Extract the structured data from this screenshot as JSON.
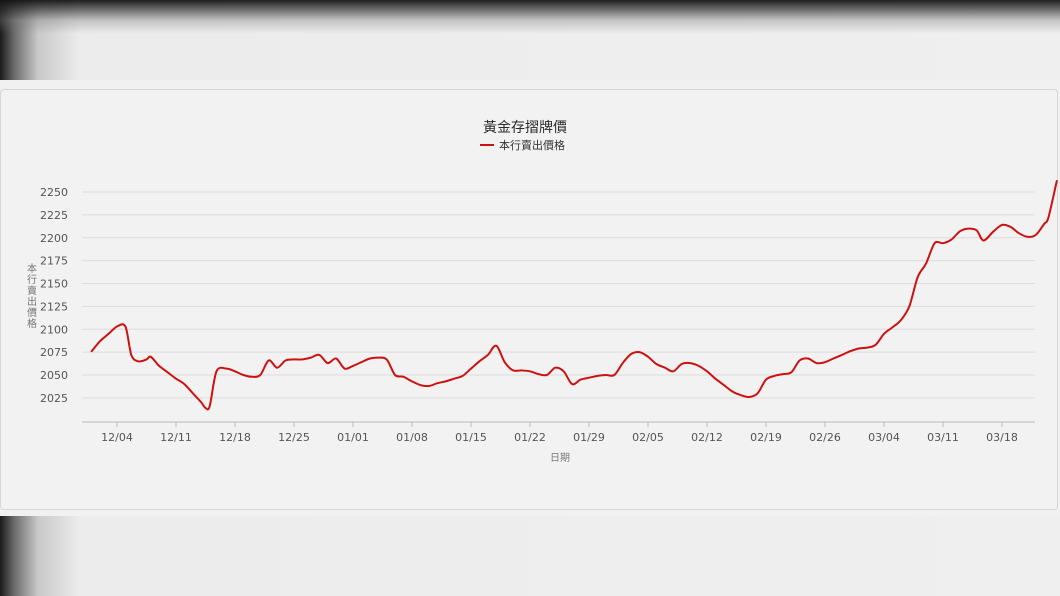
{
  "chart_data": {
    "type": "line",
    "title": "黃金存摺牌價",
    "xlabel": "日期",
    "ylabel": "本行賣出價格",
    "legend": "top-center",
    "grid": true,
    "x_tick_labels": [
      "12/04",
      "12/11",
      "12/18",
      "12/25",
      "01/01",
      "01/08",
      "01/15",
      "01/22",
      "01/29",
      "02/05",
      "02/12",
      "02/19",
      "02/26",
      "03/04",
      "03/11",
      "03/18"
    ],
    "y_ticks": [
      2025,
      2050,
      2075,
      2100,
      2125,
      2150,
      2175,
      2200,
      2225,
      2250
    ],
    "ylim": [
      2000,
      2262
    ],
    "x_range_days": [
      -3,
      107
    ],
    "series": [
      {
        "name": "本行賣出價格",
        "color": "#cc1111",
        "points": [
          [
            -3,
            2076
          ],
          [
            -2,
            2087
          ],
          [
            -1,
            2095
          ],
          [
            0,
            2103
          ],
          [
            1,
            2103
          ],
          [
            1.7,
            2072
          ],
          [
            2.5,
            2065
          ],
          [
            3.5,
            2067
          ],
          [
            4,
            2070
          ],
          [
            5,
            2060
          ],
          [
            6,
            2053
          ],
          [
            7,
            2046
          ],
          [
            8,
            2040
          ],
          [
            9,
            2030
          ],
          [
            10,
            2020
          ],
          [
            10.5,
            2014
          ],
          [
            11,
            2016
          ],
          [
            11.8,
            2054
          ],
          [
            13,
            2057
          ],
          [
            14,
            2054
          ],
          [
            15,
            2050
          ],
          [
            16,
            2048
          ],
          [
            17,
            2050
          ],
          [
            18,
            2066
          ],
          [
            19,
            2058
          ],
          [
            20,
            2066
          ],
          [
            21,
            2067
          ],
          [
            22,
            2067
          ],
          [
            23,
            2069
          ],
          [
            24,
            2072
          ],
          [
            25,
            2063
          ],
          [
            26,
            2068
          ],
          [
            27,
            2057
          ],
          [
            28,
            2060
          ],
          [
            29,
            2064
          ],
          [
            30,
            2068
          ],
          [
            31,
            2069
          ],
          [
            32,
            2067
          ],
          [
            33,
            2050
          ],
          [
            34,
            2048
          ],
          [
            35,
            2043
          ],
          [
            36,
            2039
          ],
          [
            37,
            2038
          ],
          [
            38,
            2041
          ],
          [
            39,
            2043
          ],
          [
            40,
            2046
          ],
          [
            41,
            2049
          ],
          [
            42,
            2057
          ],
          [
            43,
            2065
          ],
          [
            44,
            2072
          ],
          [
            45,
            2082
          ],
          [
            46,
            2064
          ],
          [
            47,
            2055
          ],
          [
            48,
            2055
          ],
          [
            49,
            2054
          ],
          [
            50,
            2051
          ],
          [
            51,
            2050
          ],
          [
            52,
            2058
          ],
          [
            53,
            2054
          ],
          [
            54,
            2040
          ],
          [
            55,
            2045
          ],
          [
            56,
            2047
          ],
          [
            57,
            2049
          ],
          [
            58,
            2050
          ],
          [
            59,
            2050
          ],
          [
            60,
            2063
          ],
          [
            61,
            2073
          ],
          [
            62,
            2075
          ],
          [
            63,
            2070
          ],
          [
            64,
            2062
          ],
          [
            65,
            2058
          ],
          [
            66,
            2054
          ],
          [
            67,
            2062
          ],
          [
            68,
            2063
          ],
          [
            69,
            2060
          ],
          [
            70,
            2054
          ],
          [
            71,
            2046
          ],
          [
            72,
            2039
          ],
          [
            73,
            2032
          ],
          [
            74,
            2028
          ],
          [
            75,
            2026
          ],
          [
            76,
            2030
          ],
          [
            77,
            2045
          ],
          [
            78,
            2049
          ],
          [
            79,
            2051
          ],
          [
            80,
            2053
          ],
          [
            81,
            2066
          ],
          [
            82,
            2068
          ],
          [
            83,
            2063
          ],
          [
            84,
            2064
          ],
          [
            85,
            2068
          ],
          [
            86,
            2072
          ],
          [
            87,
            2076
          ],
          [
            88,
            2079
          ],
          [
            89,
            2080
          ],
          [
            90,
            2083
          ],
          [
            91,
            2095
          ],
          [
            92,
            2102
          ],
          [
            93,
            2110
          ],
          [
            94,
            2125
          ],
          [
            95,
            2157
          ],
          [
            96,
            2172
          ],
          [
            97,
            2194
          ],
          [
            98,
            2194
          ],
          [
            99,
            2198
          ],
          [
            100,
            2207
          ],
          [
            101,
            2210
          ],
          [
            102,
            2208
          ],
          [
            102.8,
            2197
          ],
          [
            104,
            2207
          ],
          [
            105,
            2214
          ],
          [
            106,
            2212
          ],
          [
            107,
            2205
          ],
          [
            108,
            2201
          ],
          [
            109,
            2203
          ],
          [
            110,
            2215
          ],
          [
            110.5,
            2222
          ],
          [
            111.5,
            2262
          ]
        ]
      }
    ]
  }
}
